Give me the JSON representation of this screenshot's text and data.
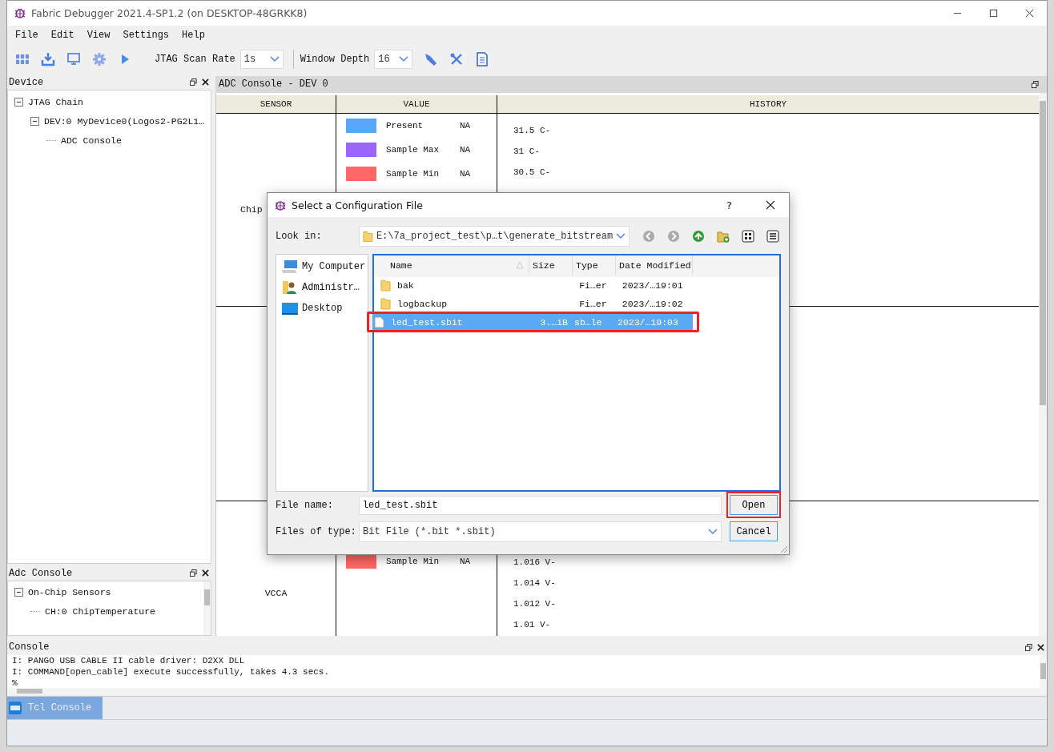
{
  "window": {
    "title": "Fabric Debugger 2021.4-SP1.2 (on DESKTOP-48GRKK8)"
  },
  "menu": [
    "File",
    "Edit",
    "View",
    "Settings",
    "Help"
  ],
  "toolbar": {
    "scan_rate_label": "JTAG Scan Rate",
    "scan_rate": "1s",
    "depth_label": "Window Depth",
    "depth": "16"
  },
  "device_panel": {
    "title": "Device",
    "tree": [
      {
        "label": "JTAG Chain",
        "expanded": true,
        "children": [
          {
            "label": "DEV:0 MyDevice0(Logos2-PG2L1…",
            "expanded": true,
            "children": [
              {
                "label": "ADC Console"
              }
            ]
          }
        ]
      }
    ]
  },
  "adc_panel": {
    "title": "Adc Console",
    "tree": [
      {
        "label": "On-Chip Sensors",
        "expanded": true,
        "children": [
          {
            "label": "CH:0 ChipTemperature"
          }
        ]
      }
    ]
  },
  "adc_console": {
    "title": "ADC Console - DEV 0",
    "columns": [
      "SENSOR",
      "VALUE",
      "HISTORY"
    ],
    "rows": [
      {
        "sensor": "Chip",
        "legend": [
          {
            "label": "Present",
            "value": "NA",
            "color": "#58a6ff"
          },
          {
            "label": "Sample Max",
            "value": "NA",
            "color": "#9966ff"
          },
          {
            "label": "Sample Min",
            "value": "NA",
            "color": "#ff6666"
          }
        ],
        "history": [
          "31.5 C-",
          "31 C-",
          "30.5 C-"
        ]
      },
      {
        "sensor": "VCCA",
        "legend": [
          {
            "label": "Sample Min",
            "value": "NA",
            "color": "#ff6666"
          }
        ],
        "history": [
          "1.016 V-",
          "1.014 V-",
          "1.012 V-",
          "1.01 V-"
        ]
      }
    ]
  },
  "console": {
    "title": "Console",
    "lines": [
      "I: PANGO USB CABLE II cable driver: D2XX DLL",
      "I: COMMAND[open_cable] execute successfully, takes 4.3 secs.",
      "%"
    ]
  },
  "bottom_tabs": [
    {
      "label": "Tcl Console",
      "selected": true
    }
  ],
  "dialog": {
    "title": "Select a Configuration File",
    "help": "?",
    "look_in_label": "Look in:",
    "look_in": "E:\\7a_project_test\\p…t\\generate_bitstream",
    "places": [
      {
        "label": "My Computer",
        "kind": "computer"
      },
      {
        "label": "Administr…",
        "kind": "user"
      },
      {
        "label": "Desktop",
        "kind": "desktop"
      }
    ],
    "columns": [
      "Name",
      "Size",
      "Type",
      "Date Modified"
    ],
    "files": [
      {
        "name": "bak",
        "type": "Fi…er",
        "modified": "2023/…19:01",
        "kind": "folder",
        "selected": false,
        "highlighted": false
      },
      {
        "name": "logbackup",
        "type": "Fi…er",
        "modified": "2023/…19:02",
        "kind": "folder",
        "selected": false,
        "highlighted": false
      },
      {
        "name": "led_test.sbit",
        "size": "3.…iB",
        "type": "sb…le",
        "modified": "2023/…19:03",
        "kind": "file",
        "selected": true,
        "highlighted": true
      }
    ],
    "file_name_label": "File name:",
    "file_name": "led_test.sbit",
    "file_type_label": "Files of type:",
    "file_type": "Bit File (*.bit *.sbit)",
    "buttons": [
      {
        "label": "Open",
        "highlighted": true
      },
      {
        "label": "Cancel",
        "highlighted": false
      }
    ]
  }
}
